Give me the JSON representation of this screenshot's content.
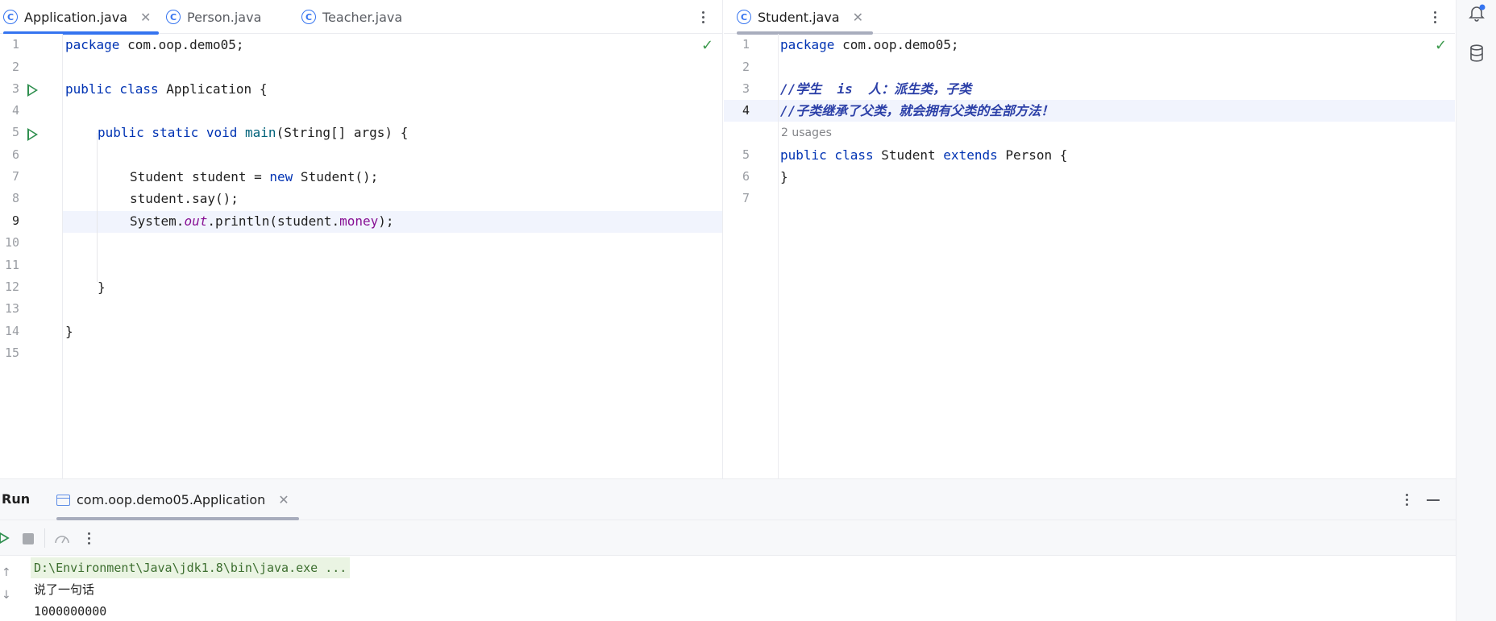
{
  "left_editor": {
    "tabs": [
      {
        "label": "Application.java",
        "active": true,
        "closable": true
      },
      {
        "label": "Person.java",
        "active": false,
        "closable": false
      },
      {
        "label": "Teacher.java",
        "active": false,
        "closable": false
      }
    ],
    "line_numbers": [
      "1",
      "2",
      "3",
      "4",
      "5",
      "6",
      "7",
      "8",
      "9",
      "10",
      "11",
      "12",
      "13",
      "14",
      "15"
    ],
    "current_line": "9",
    "code": {
      "l1_kw": "package",
      "l1_rest": " com.oop.demo05;",
      "l3_kw": "public class",
      "l3_rest": " Application {",
      "l5_kw": "public static void",
      "l5_name": " main",
      "l5_rest": "(String[] args) {",
      "l7_type": "Student student = ",
      "l7_kw": "new",
      "l7_rest": " Student();",
      "l8": "student.say();",
      "l9_a": "System.",
      "l9_out": "out",
      "l9_b": ".println(student.",
      "l9_field": "money",
      "l9_c": ");",
      "l12": "}",
      "l14": "}"
    }
  },
  "right_editor": {
    "tabs": [
      {
        "label": "Student.java",
        "active": true,
        "closable": true
      }
    ],
    "line_numbers": [
      "1",
      "2",
      "3",
      "4",
      "5",
      "6",
      "7"
    ],
    "current_line": "4",
    "usages_hint": "2 usages",
    "code": {
      "l1_kw": "package",
      "l1_rest": " com.oop.demo05;",
      "l3_comment": "//学生  is  人：派生类，子类",
      "l4_comment": "//子类继承了父类，就会拥有父类的全部方法！",
      "l5_kw1": "public class",
      "l5_name": " Student ",
      "l5_kw2": "extends",
      "l5_rest": " Person {",
      "l6": "}"
    }
  },
  "run_panel": {
    "title": "Run",
    "tab_label": "com.oop.demo05.Application",
    "console_lines": [
      "D:\\Environment\\Java\\jdk1.8\\bin\\java.exe ...",
      "说了一句话",
      "1000000000"
    ]
  },
  "icons": {
    "tab_file": "class-c-icon",
    "check": "check-icon",
    "notifications": "bell-icon",
    "database": "database-icon"
  },
  "colors": {
    "accent": "#3574f0",
    "keyword": "#0033b3",
    "field": "#871094",
    "comment": "#2c40a8",
    "run_green": "#2f8f4f",
    "notification_dot": "#3574f0"
  }
}
